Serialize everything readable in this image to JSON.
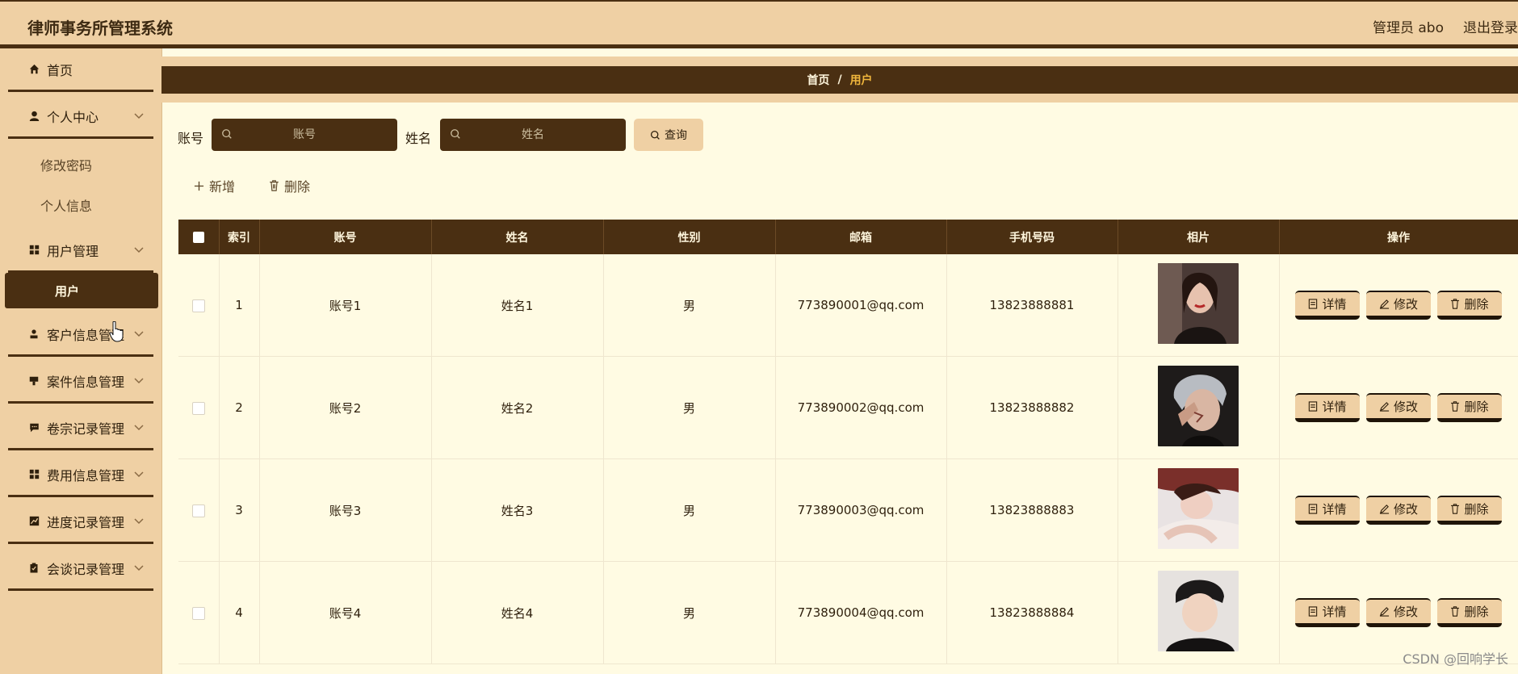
{
  "app": {
    "title": "律师事务所管理系统"
  },
  "header": {
    "admin": "管理员 abo",
    "logout": "退出登录"
  },
  "sidebar": {
    "items": [
      {
        "label": "首页",
        "icon": "home-icon"
      },
      {
        "label": "个人中心",
        "icon": "user-icon"
      },
      {
        "label": "用户管理",
        "icon": "grid-icon"
      },
      {
        "label": "客户信息管理",
        "icon": "person-icon"
      },
      {
        "label": "案件信息管理",
        "icon": "stamp-icon"
      },
      {
        "label": "卷宗记录管理",
        "icon": "chat-icon"
      },
      {
        "label": "费用信息管理",
        "icon": "grid-icon"
      },
      {
        "label": "进度记录管理",
        "icon": "chart-icon"
      },
      {
        "label": "会谈记录管理",
        "icon": "clipboard-icon"
      }
    ],
    "sub_personal": [
      "修改密码",
      "个人信息"
    ],
    "sub_user_active": "用户"
  },
  "breadcrumb": {
    "home": "首页",
    "sep": "/",
    "current": "用户"
  },
  "search": {
    "account_label": "账号",
    "account_placeholder": "账号",
    "name_label": "姓名",
    "name_placeholder": "姓名",
    "query_label": "查询"
  },
  "toolbar": {
    "add_label": "新增",
    "delete_label": "删除"
  },
  "table": {
    "headers": [
      "索引",
      "账号",
      "姓名",
      "性别",
      "邮箱",
      "手机号码",
      "相片",
      "操作"
    ],
    "rows": [
      {
        "index": "1",
        "account": "账号1",
        "name": "姓名1",
        "gender": "男",
        "email": "773890001@qq.com",
        "phone": "13823888881"
      },
      {
        "index": "2",
        "account": "账号2",
        "name": "姓名2",
        "gender": "男",
        "email": "773890002@qq.com",
        "phone": "13823888882"
      },
      {
        "index": "3",
        "account": "账号3",
        "name": "姓名3",
        "gender": "男",
        "email": "773890003@qq.com",
        "phone": "13823888883"
      },
      {
        "index": "4",
        "account": "账号4",
        "name": "姓名4",
        "gender": "男",
        "email": "773890004@qq.com",
        "phone": "13823888884"
      }
    ],
    "actions": {
      "detail": "详情",
      "edit": "修改",
      "delete": "删除"
    }
  },
  "watermark": "CSDN @回响学长",
  "colors": {
    "primary": "#4a2f12",
    "tan": "#efd0a4",
    "background": "#fffbe3",
    "accent": "#f0b63c"
  }
}
